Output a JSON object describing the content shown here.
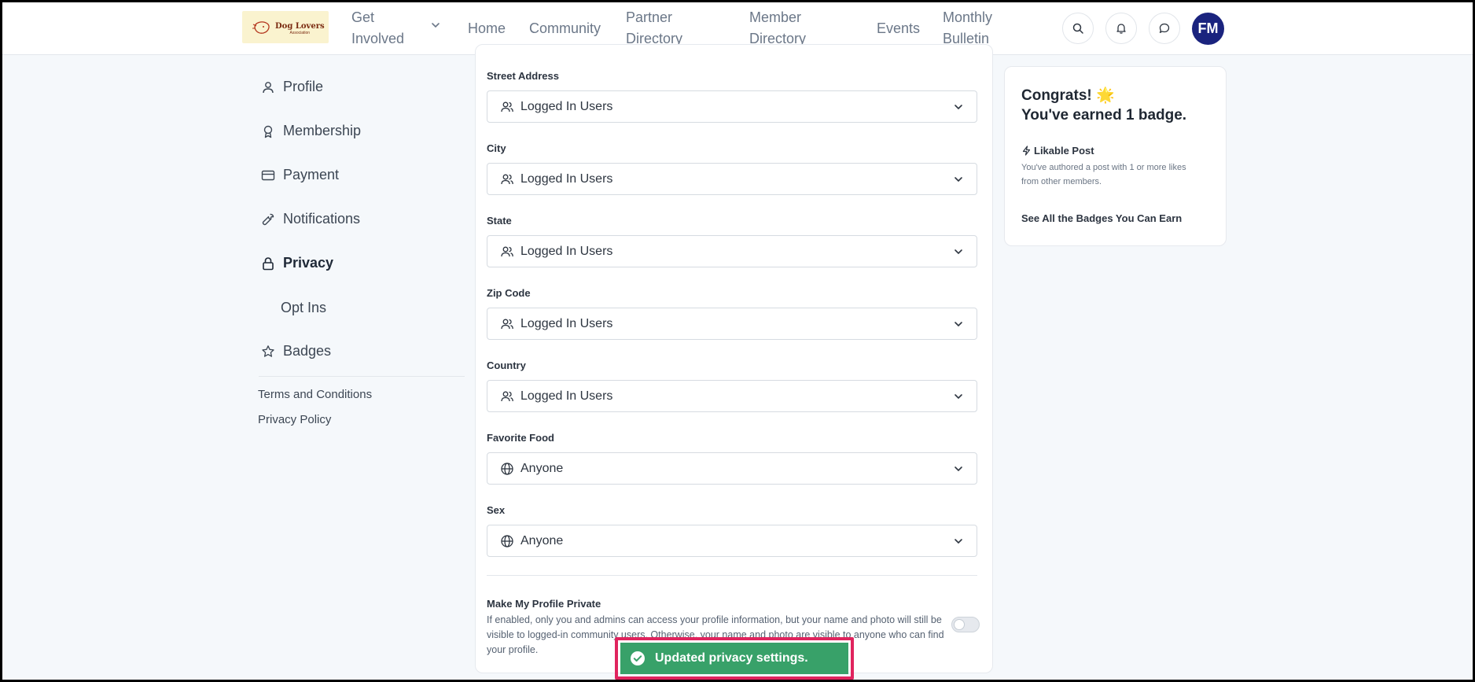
{
  "header": {
    "logo_text": "Dog Lovers",
    "logo_subtext": "Association",
    "nav": {
      "get_involved_l1": "Get",
      "get_involved_l2": "Involved",
      "home": "Home",
      "community": "Community",
      "partner_l1": "Partner",
      "partner_l2": "Directory",
      "member_l1": "Member",
      "member_l2": "Directory",
      "events": "Events",
      "bulletin_l1": "Monthly",
      "bulletin_l2": "Bulletin"
    },
    "avatar_initials": "FM"
  },
  "sidebar": {
    "items": [
      {
        "label": "Profile",
        "icon": "user-icon"
      },
      {
        "label": "Membership",
        "icon": "award-icon"
      },
      {
        "label": "Payment",
        "icon": "credit-card-icon"
      },
      {
        "label": "Notifications",
        "icon": "wrench-icon"
      },
      {
        "label": "Privacy",
        "icon": "lock-icon"
      },
      {
        "label": "Opt Ins",
        "icon": ""
      },
      {
        "label": "Badges",
        "icon": "star-icon"
      }
    ],
    "links": {
      "terms": "Terms and Conditions",
      "privacy_policy": "Privacy Policy"
    }
  },
  "privacy": {
    "fields": [
      {
        "label": "Street Address",
        "value": "Logged In Users",
        "icon": "users-icon"
      },
      {
        "label": "City",
        "value": "Logged In Users",
        "icon": "users-icon"
      },
      {
        "label": "State",
        "value": "Logged In Users",
        "icon": "users-icon"
      },
      {
        "label": "Zip Code",
        "value": "Logged In Users",
        "icon": "users-icon"
      },
      {
        "label": "Country",
        "value": "Logged In Users",
        "icon": "users-icon"
      },
      {
        "label": "Favorite Food",
        "value": "Anyone",
        "icon": "globe-icon"
      },
      {
        "label": "Sex",
        "value": "Anyone",
        "icon": "globe-icon"
      }
    ],
    "private_profile": {
      "title": "Make My Profile Private",
      "description": "If enabled, only you and admins can access your profile information, but your name and photo will still be visible to logged-in community users. Otherwise, your name and photo are visible to anyone who can find your profile.",
      "enabled": false
    }
  },
  "badges": {
    "congrats_l1": "Congrats! 🌟",
    "congrats_l2": "You've earned 1 badge.",
    "badge_name": "Likable Post",
    "badge_desc": "You've authored a post with 1 or more likes from other members.",
    "link": "See All the Badges You Can Earn"
  },
  "toast": {
    "message": "Updated privacy settings."
  },
  "colors": {
    "avatar_bg": "#1a237e",
    "toast_bg": "#38a169",
    "highlight": "#e0245e"
  }
}
